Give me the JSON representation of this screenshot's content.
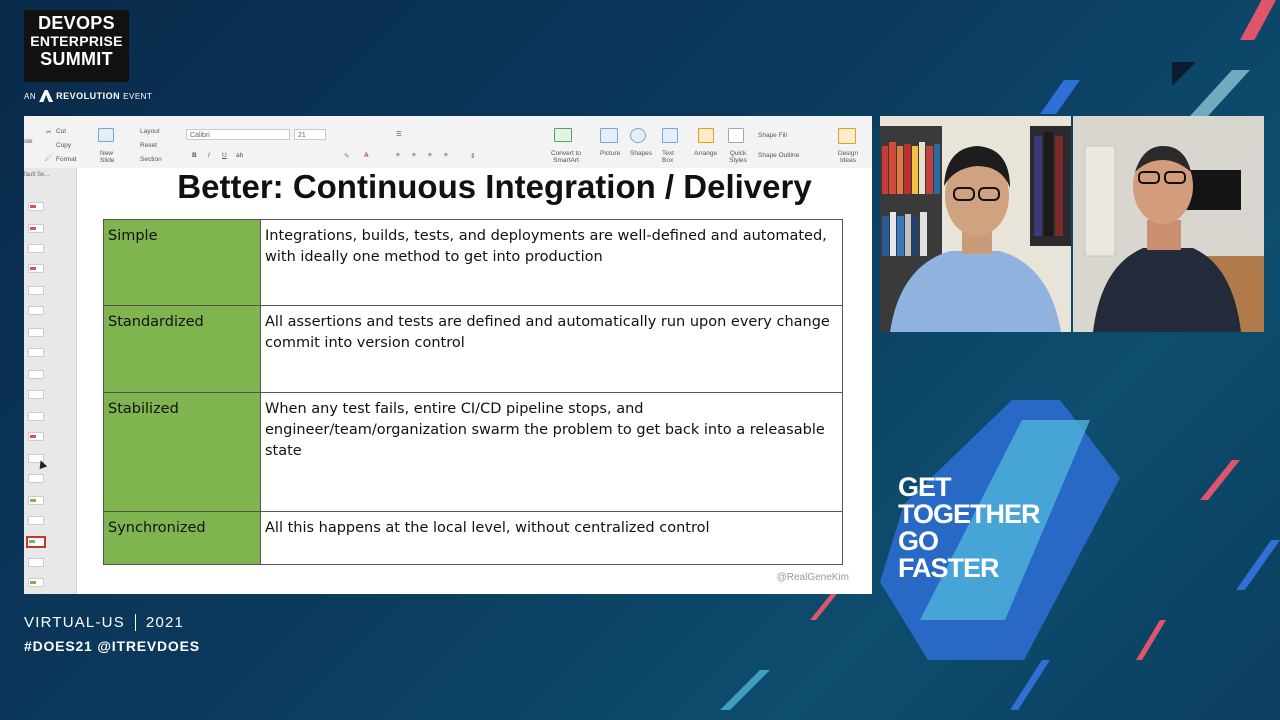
{
  "branding": {
    "logo_line1": "DEVOPS",
    "logo_line2": "ENTERPRISE",
    "logo_line3": "SUMMIT",
    "sub_prefix": "AN",
    "sub_brand": "REVOLUTION",
    "sub_suffix": "EVENT"
  },
  "event": {
    "name": "VIRTUAL-US",
    "year": "2021",
    "hashtags": "#DOES21 @ITREVDOES"
  },
  "slogan": [
    "GET",
    "TOGETHER",
    "GO",
    "FASTER"
  ],
  "ribbon": {
    "cut": "Cut",
    "copy": "Copy",
    "format": "Format",
    "paste": "ste",
    "new_slide": "New Slide",
    "layout": "Layout",
    "reset": "Reset",
    "section": "Section",
    "font_name": "Calibri",
    "font_size": "21",
    "convert": "Convert to SmartArt",
    "picture": "Picture",
    "shapes": "Shapes",
    "text_box": "Text Box",
    "arrange": "Arrange",
    "quick_styles": "Quick Styles",
    "shape_fill": "Shape Fill",
    "shape_outline": "Shape Outline",
    "design_ideas": "Design Ideas",
    "panel_title": "fault Se..."
  },
  "slide": {
    "title": "Better: Continuous Integration / Delivery",
    "rows": [
      {
        "key": "Simple",
        "value": "Integrations, builds, tests, and deployments are well-defined and automated, with ideally one method to get into production"
      },
      {
        "key": "Standardized",
        "value": "All assertions and tests are defined and automatically run upon every change commit into version control"
      },
      {
        "key": "Stabilized",
        "value": "When any test fails, entire CI/CD pipeline stops, and engineer/team/organization swarm the problem to get back into a releasable state"
      },
      {
        "key": "Synchronized",
        "value": "All this happens at the local level, without centralized control"
      }
    ],
    "handle": "@RealGeneKim"
  },
  "colors": {
    "table_key_bg": "#7fb44f",
    "background": "#0b3a5e"
  }
}
